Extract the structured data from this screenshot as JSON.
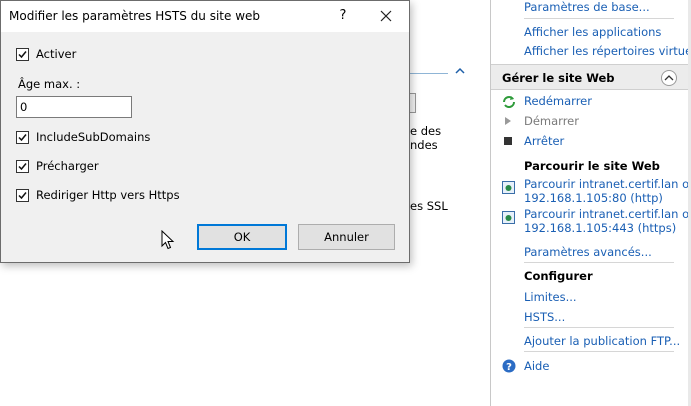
{
  "background": {
    "snippet_1": "e des",
    "snippet_2": "ndes",
    "snippet_3": "es SSL"
  },
  "actions": {
    "links_top": [
      "Paramètres de base...",
      "Afficher les applications",
      "Afficher les répertoires virtuels"
    ],
    "manage_header": "Gérer le site Web",
    "restart": "Redémarrer",
    "start": "Démarrer",
    "stop": "Arrêter",
    "browse_header": "Parcourir le site Web",
    "browse_http_1": "Parcourir intranet.certif.lan on",
    "browse_http_2": "192.168.1.105:80 (http)",
    "browse_https_1": "Parcourir intranet.certif.lan on",
    "browse_https_2": "192.168.1.105:443 (https)",
    "advanced": "Paramètres avancés...",
    "configure_header": "Configurer",
    "limits": "Limites...",
    "hsts": "HSTS...",
    "ftp": "Ajouter la publication FTP...",
    "help": "Aide"
  },
  "dialog": {
    "title": "Modifier les paramètres HSTS du site web",
    "help_glyph": "?",
    "enable_label": "Activer",
    "enable_checked": true,
    "max_age_label": "Âge max. :",
    "max_age_value": "0",
    "include_subdomains_label": "IncludeSubDomains",
    "include_subdomains_checked": true,
    "preload_label": "Précharger",
    "preload_checked": true,
    "redirect_label": "Rediriger Http vers Https",
    "redirect_checked": true,
    "ok_label": "OK",
    "cancel_label": "Annuler"
  },
  "colors": {
    "link": "#1a5fb4",
    "ok_border": "#0078d7"
  }
}
